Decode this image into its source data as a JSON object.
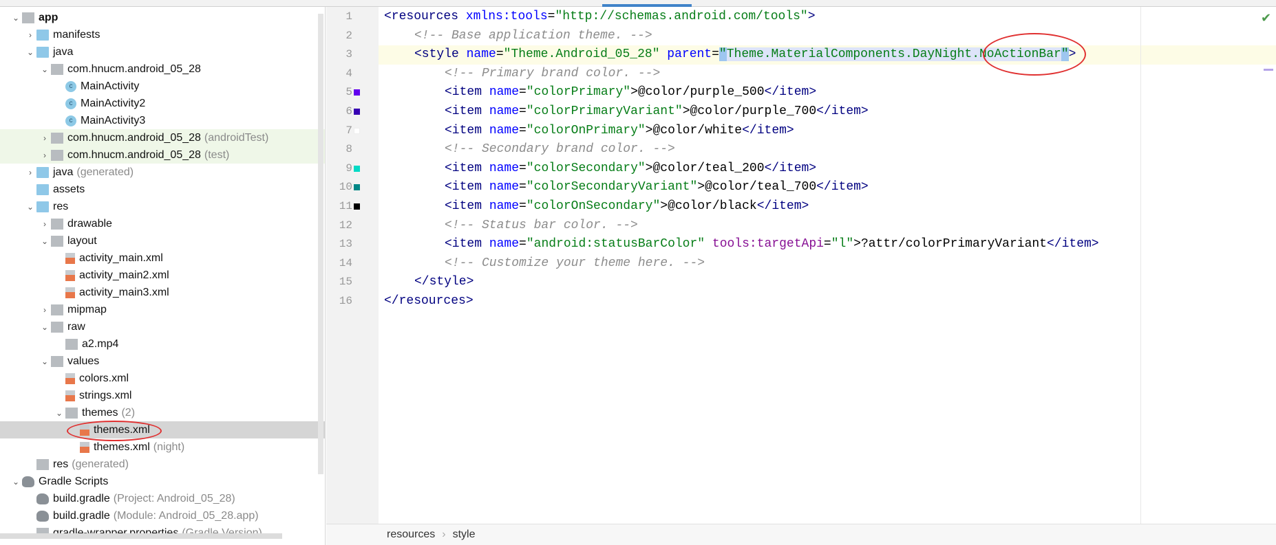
{
  "tree": [
    {
      "label": "app",
      "depth": 0,
      "arrow": "open",
      "icon": "module",
      "bold": true
    },
    {
      "label": "manifests",
      "depth": 1,
      "arrow": "closed",
      "icon": "folder"
    },
    {
      "label": "java",
      "depth": 1,
      "arrow": "open",
      "icon": "folder"
    },
    {
      "label": "com.hnucm.android_05_28",
      "depth": 2,
      "arrow": "open",
      "icon": "package"
    },
    {
      "label": "MainActivity",
      "depth": 3,
      "arrow": "none",
      "icon": "class"
    },
    {
      "label": "MainActivity2",
      "depth": 3,
      "arrow": "none",
      "icon": "class"
    },
    {
      "label": "MainActivity3",
      "depth": 3,
      "arrow": "none",
      "icon": "class"
    },
    {
      "label": "com.hnucm.android_05_28",
      "suffix": "(androidTest)",
      "depth": 2,
      "arrow": "closed",
      "icon": "package",
      "state": "green"
    },
    {
      "label": "com.hnucm.android_05_28",
      "suffix": "(test)",
      "depth": 2,
      "arrow": "closed",
      "icon": "package",
      "state": "green"
    },
    {
      "label": "java",
      "suffix": "(generated)",
      "depth": 1,
      "arrow": "closed",
      "icon": "folder"
    },
    {
      "label": "assets",
      "depth": 1,
      "arrow": "none",
      "icon": "folder"
    },
    {
      "label": "res",
      "depth": 1,
      "arrow": "open",
      "icon": "folder"
    },
    {
      "label": "drawable",
      "depth": 2,
      "arrow": "closed",
      "icon": "package"
    },
    {
      "label": "layout",
      "depth": 2,
      "arrow": "open",
      "icon": "package"
    },
    {
      "label": "activity_main.xml",
      "depth": 3,
      "arrow": "none",
      "icon": "xml"
    },
    {
      "label": "activity_main2.xml",
      "depth": 3,
      "arrow": "none",
      "icon": "xml"
    },
    {
      "label": "activity_main3.xml",
      "depth": 3,
      "arrow": "none",
      "icon": "xml"
    },
    {
      "label": "mipmap",
      "depth": 2,
      "arrow": "closed",
      "icon": "package"
    },
    {
      "label": "raw",
      "depth": 2,
      "arrow": "open",
      "icon": "package"
    },
    {
      "label": "a2.mp4",
      "depth": 3,
      "arrow": "none",
      "icon": "file"
    },
    {
      "label": "values",
      "depth": 2,
      "arrow": "open",
      "icon": "package"
    },
    {
      "label": "colors.xml",
      "depth": 3,
      "arrow": "none",
      "icon": "xml"
    },
    {
      "label": "strings.xml",
      "depth": 3,
      "arrow": "none",
      "icon": "xml"
    },
    {
      "label": "themes",
      "suffix": "(2)",
      "depth": 3,
      "arrow": "open",
      "icon": "package"
    },
    {
      "label": "themes.xml",
      "depth": 4,
      "arrow": "none",
      "icon": "xml",
      "state": "sel"
    },
    {
      "label": "themes.xml",
      "suffix": "(night)",
      "depth": 4,
      "arrow": "none",
      "icon": "xml"
    },
    {
      "label": "res",
      "suffix": "(generated)",
      "depth": 1,
      "arrow": "none",
      "icon": "folder-gen"
    },
    {
      "label": "Gradle Scripts",
      "depth": 0,
      "arrow": "open",
      "icon": "gradle"
    },
    {
      "label": "build.gradle",
      "suffix": "(Project: Android_05_28)",
      "depth": 1,
      "arrow": "none",
      "icon": "gradle"
    },
    {
      "label": "build.gradle",
      "suffix": "(Module: Android_05_28.app)",
      "depth": 1,
      "arrow": "none",
      "icon": "gradle"
    },
    {
      "label": "gradle-wrapper.properties",
      "suffix": "(Gradle Version)",
      "depth": 1,
      "arrow": "none",
      "icon": "properties"
    }
  ],
  "editor": {
    "current_line": 3,
    "lines": [
      {
        "n": "1",
        "indent": 0,
        "tokens": [
          [
            "tag",
            "<resources "
          ],
          [
            "attr",
            "xmlns:tools"
          ],
          [
            "text",
            "="
          ],
          [
            "str",
            "\"http://schemas.android.com/tools\""
          ],
          [
            "tag",
            ">"
          ]
        ]
      },
      {
        "n": "2",
        "indent": 1,
        "tokens": [
          [
            "comment",
            "<!-- Base application theme. -->"
          ]
        ]
      },
      {
        "n": "3",
        "indent": 1,
        "tokens": [
          [
            "tag",
            "<style "
          ],
          [
            "attr",
            "name"
          ],
          [
            "text",
            "="
          ],
          [
            "str",
            "\"Theme.Android_05_28\" "
          ],
          [
            "attr",
            "parent"
          ],
          [
            "text",
            "="
          ],
          [
            "str q",
            "\""
          ],
          [
            "str hl",
            "Theme.MaterialComponents.DayNight.NoActionBar"
          ],
          [
            "str q",
            "\""
          ],
          [
            "tag",
            ">"
          ]
        ]
      },
      {
        "n": "4",
        "indent": 2,
        "tokens": [
          [
            "comment",
            "<!-- Primary brand color. -->"
          ]
        ]
      },
      {
        "n": "5",
        "indent": 2,
        "swatch": "#6200ee",
        "tokens": [
          [
            "tag",
            "<item "
          ],
          [
            "attr",
            "name"
          ],
          [
            "text",
            "="
          ],
          [
            "str",
            "\"colorPrimary\""
          ],
          [
            "text",
            ">@color/purple_500"
          ],
          [
            "tag",
            "</item>"
          ]
        ]
      },
      {
        "n": "6",
        "indent": 2,
        "swatch": "#3700b3",
        "tokens": [
          [
            "tag",
            "<item "
          ],
          [
            "attr",
            "name"
          ],
          [
            "text",
            "="
          ],
          [
            "str",
            "\"colorPrimaryVariant\""
          ],
          [
            "text",
            ">@color/purple_700"
          ],
          [
            "tag",
            "</item>"
          ]
        ]
      },
      {
        "n": "7",
        "indent": 2,
        "swatch": "#ffffff",
        "tokens": [
          [
            "tag",
            "<item "
          ],
          [
            "attr",
            "name"
          ],
          [
            "text",
            "="
          ],
          [
            "str",
            "\"colorOnPrimary\""
          ],
          [
            "text",
            ">@color/white"
          ],
          [
            "tag",
            "</item>"
          ]
        ]
      },
      {
        "n": "8",
        "indent": 2,
        "tokens": [
          [
            "comment",
            "<!-- Secondary brand color. -->"
          ]
        ]
      },
      {
        "n": "9",
        "indent": 2,
        "swatch": "#03dac5",
        "tokens": [
          [
            "tag",
            "<item "
          ],
          [
            "attr",
            "name"
          ],
          [
            "text",
            "="
          ],
          [
            "str",
            "\"colorSecondary\""
          ],
          [
            "text",
            ">@color/teal_200"
          ],
          [
            "tag",
            "</item>"
          ]
        ]
      },
      {
        "n": "10",
        "indent": 2,
        "swatch": "#018786",
        "tokens": [
          [
            "tag",
            "<item "
          ],
          [
            "attr",
            "name"
          ],
          [
            "text",
            "="
          ],
          [
            "str",
            "\"colorSecondaryVariant\""
          ],
          [
            "text",
            ">@color/teal_700"
          ],
          [
            "tag",
            "</item>"
          ]
        ]
      },
      {
        "n": "11",
        "indent": 2,
        "swatch": "#000000",
        "tokens": [
          [
            "tag",
            "<item "
          ],
          [
            "attr",
            "name"
          ],
          [
            "text",
            "="
          ],
          [
            "str",
            "\"colorOnSecondary\""
          ],
          [
            "text",
            ">@color/black"
          ],
          [
            "tag",
            "</item>"
          ]
        ]
      },
      {
        "n": "12",
        "indent": 2,
        "tokens": [
          [
            "comment",
            "<!-- Status bar color. -->"
          ]
        ]
      },
      {
        "n": "13",
        "indent": 2,
        "tokens": [
          [
            "tag",
            "<item "
          ],
          [
            "attr",
            "name"
          ],
          [
            "text",
            "="
          ],
          [
            "str",
            "\"android:statusBarColor\" "
          ],
          [
            "ns",
            "tools:targetApi"
          ],
          [
            "text",
            "="
          ],
          [
            "str",
            "\"l\""
          ],
          [
            "text",
            ">?attr/colorPrimaryVariant"
          ],
          [
            "tag",
            "</item>"
          ]
        ]
      },
      {
        "n": "14",
        "indent": 2,
        "tokens": [
          [
            "comment",
            "<!-- Customize your theme here. -->"
          ]
        ]
      },
      {
        "n": "15",
        "indent": 1,
        "tokens": [
          [
            "tag",
            "</style>"
          ]
        ]
      },
      {
        "n": "16",
        "indent": 0,
        "tokens": [
          [
            "tag",
            "</resources>"
          ]
        ]
      }
    ]
  },
  "breadcrumb": [
    "resources",
    "style"
  ],
  "colors": {
    "accent": "#4083c9",
    "annotation": "#e03030",
    "inspection_ok": "#4c9a4c"
  }
}
